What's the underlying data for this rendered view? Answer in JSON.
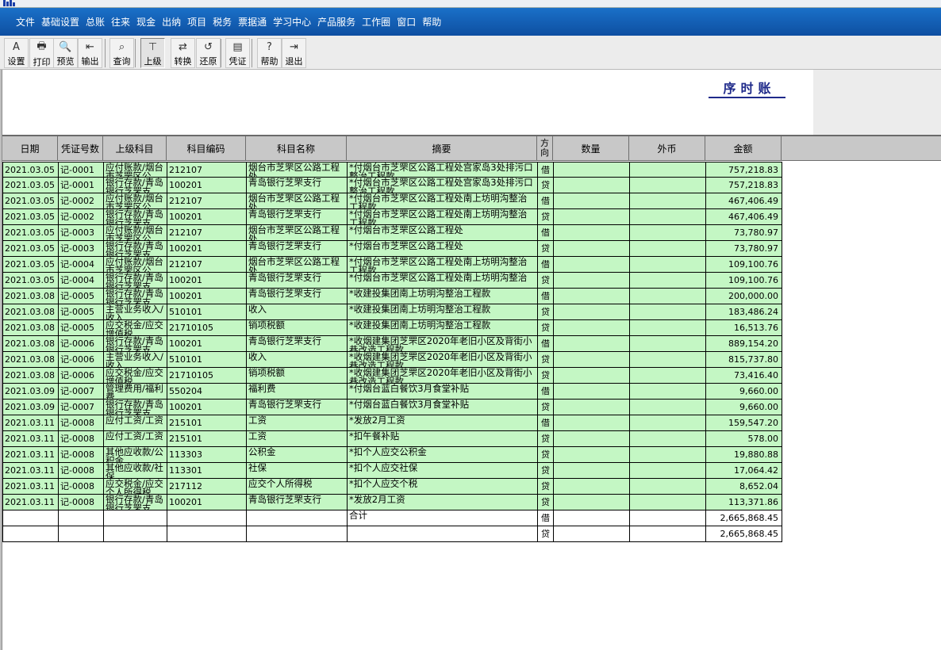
{
  "menu": [
    "文件",
    "基础设置",
    "总账",
    "往来",
    "现金",
    "出纳",
    "项目",
    "税务",
    "票据通",
    "学习中心",
    "产品服务",
    "工作圈",
    "窗口",
    "帮助"
  ],
  "toolbar": [
    {
      "label": "设置",
      "icon": "settings-icon",
      "glyph": "A"
    },
    {
      "label": "打印",
      "icon": "printer-icon",
      "glyph": "🖶"
    },
    {
      "label": "预览",
      "icon": "preview-icon",
      "glyph": "🔍"
    },
    {
      "label": "输出",
      "icon": "export-icon",
      "glyph": "⇤"
    },
    {
      "label": "查询",
      "icon": "binoculars-icon",
      "glyph": "⌕"
    },
    {
      "label": "上级",
      "icon": "parent-level-icon",
      "glyph": "⊤"
    },
    {
      "label": "转换",
      "icon": "convert-icon",
      "glyph": "⇄"
    },
    {
      "label": "还原",
      "icon": "restore-icon",
      "glyph": "↺"
    },
    {
      "label": "凭证",
      "icon": "voucher-icon",
      "glyph": "▤"
    },
    {
      "label": "帮助",
      "icon": "help-icon",
      "glyph": "?"
    },
    {
      "label": "退出",
      "icon": "exit-icon",
      "glyph": "⇥"
    }
  ],
  "report": {
    "title": "序时账"
  },
  "columns": [
    "日期",
    "凭证号数",
    "上级科目",
    "科目编码",
    "科目名称",
    "摘要",
    "方向",
    "数量",
    "外币",
    "金额"
  ],
  "rows": [
    [
      "2021.03.05",
      "记-0001",
      "应付账款/烟台市芝罘区公",
      "212107",
      "烟台市芝罘区公路工程处",
      "*付烟台市芝罘区公路工程处宫家岛3处排污口整治工程款",
      "借",
      "",
      "",
      "757,218.83"
    ],
    [
      "2021.03.05",
      "记-0001",
      "银行存款/青岛银行芝罘支",
      "100201",
      "青岛银行芝罘支行",
      "*付烟台市芝罘区公路工程处宫家岛3处排污口整治工程款",
      "贷",
      "",
      "",
      "757,218.83"
    ],
    [
      "2021.03.05",
      "记-0002",
      "应付账款/烟台市芝罘区公",
      "212107",
      "烟台市芝罘区公路工程处",
      "*付烟台市芝罘区公路工程处南上坊明沟整治工程款",
      "借",
      "",
      "",
      "467,406.49"
    ],
    [
      "2021.03.05",
      "记-0002",
      "银行存款/青岛银行芝罘支",
      "100201",
      "青岛银行芝罘支行",
      "*付烟台市芝罘区公路工程处南上坊明沟整治工程款",
      "贷",
      "",
      "",
      "467,406.49"
    ],
    [
      "2021.03.05",
      "记-0003",
      "应付账款/烟台市芝罘区公",
      "212107",
      "烟台市芝罘区公路工程处",
      "*付烟台市芝罘区公路工程处",
      "借",
      "",
      "",
      "73,780.97"
    ],
    [
      "2021.03.05",
      "记-0003",
      "银行存款/青岛银行芝罘支",
      "100201",
      "青岛银行芝罘支行",
      "*付烟台市芝罘区公路工程处",
      "贷",
      "",
      "",
      "73,780.97"
    ],
    [
      "2021.03.05",
      "记-0004",
      "应付账款/烟台市芝罘区公",
      "212107",
      "烟台市芝罘区公路工程处",
      "*付烟台市芝罘区公路工程处南上坊明沟整治工程款",
      "借",
      "",
      "",
      "109,100.76"
    ],
    [
      "2021.03.05",
      "记-0004",
      "银行存款/青岛银行芝罘支",
      "100201",
      "青岛银行芝罘支行",
      "*付烟台市芝罘区公路工程处南上坊明沟整治",
      "贷",
      "",
      "",
      "109,100.76"
    ],
    [
      "2021.03.08",
      "记-0005",
      "银行存款/青岛银行芝罘支",
      "100201",
      "青岛银行芝罘支行",
      "*收建投集团南上坊明沟整治工程款",
      "借",
      "",
      "",
      "200,000.00"
    ],
    [
      "2021.03.08",
      "记-0005",
      "主营业务收入/收入",
      "510101",
      "收入",
      "*收建投集团南上坊明沟整治工程款",
      "贷",
      "",
      "",
      "183,486.24"
    ],
    [
      "2021.03.08",
      "记-0005",
      "应交税金/应交增值税",
      "21710105",
      "销项税额",
      "*收建投集团南上坊明沟整治工程款",
      "贷",
      "",
      "",
      "16,513.76"
    ],
    [
      "2021.03.08",
      "记-0006",
      "银行存款/青岛银行芝罘支",
      "100201",
      "青岛银行芝罘支行",
      "*收烟建集团芝罘区2020年老旧小区及背街小巷改造工程款",
      "借",
      "",
      "",
      "889,154.20"
    ],
    [
      "2021.03.08",
      "记-0006",
      "主营业务收入/收入",
      "510101",
      "收入",
      "*收烟建集团芝罘区2020年老旧小区及背街小巷改造工程款",
      "贷",
      "",
      "",
      "815,737.80"
    ],
    [
      "2021.03.08",
      "记-0006",
      "应交税金/应交增值税",
      "21710105",
      "销项税额",
      "*收烟建集团芝罘区2020年老旧小区及背街小巷改造工程款",
      "贷",
      "",
      "",
      "73,416.40"
    ],
    [
      "2021.03.09",
      "记-0007",
      "管理费用/福利费",
      "550204",
      "福利费",
      "*付烟台蓝白餐饮3月食堂补贴",
      "借",
      "",
      "",
      "9,660.00"
    ],
    [
      "2021.03.09",
      "记-0007",
      "银行存款/青岛银行芝罘支",
      "100201",
      "青岛银行芝罘支行",
      "*付烟台蓝白餐饮3月食堂补贴",
      "贷",
      "",
      "",
      "9,660.00"
    ],
    [
      "2021.03.11",
      "记-0008",
      "应付工资/工资",
      "215101",
      "工资",
      "*发放2月工资",
      "借",
      "",
      "",
      "159,547.20"
    ],
    [
      "2021.03.11",
      "记-0008",
      "应付工资/工资",
      "215101",
      "工资",
      "*扣午餐补贴",
      "贷",
      "",
      "",
      "578.00"
    ],
    [
      "2021.03.11",
      "记-0008",
      "其他应收款/公积金",
      "113303",
      "公积金",
      "*扣个人应交公积金",
      "贷",
      "",
      "",
      "19,880.88"
    ],
    [
      "2021.03.11",
      "记-0008",
      "其他应收款/社保",
      "113301",
      "社保",
      "*扣个人应交社保",
      "贷",
      "",
      "",
      "17,064.42"
    ],
    [
      "2021.03.11",
      "记-0008",
      "应交税金/应交个人所得税",
      "217112",
      "应交个人所得税",
      "*扣个人应交个税",
      "贷",
      "",
      "",
      "8,652.04"
    ],
    [
      "2021.03.11",
      "记-0008",
      "银行存款/青岛银行芝罘支",
      "100201",
      "青岛银行芝罘支行",
      "*发放2月工资",
      "贷",
      "",
      "",
      "113,371.86"
    ]
  ],
  "totals": [
    {
      "label": "合计",
      "direction": "借",
      "amount": "2,665,868.45"
    },
    {
      "label": "",
      "direction": "贷",
      "amount": "2,665,868.45"
    }
  ]
}
